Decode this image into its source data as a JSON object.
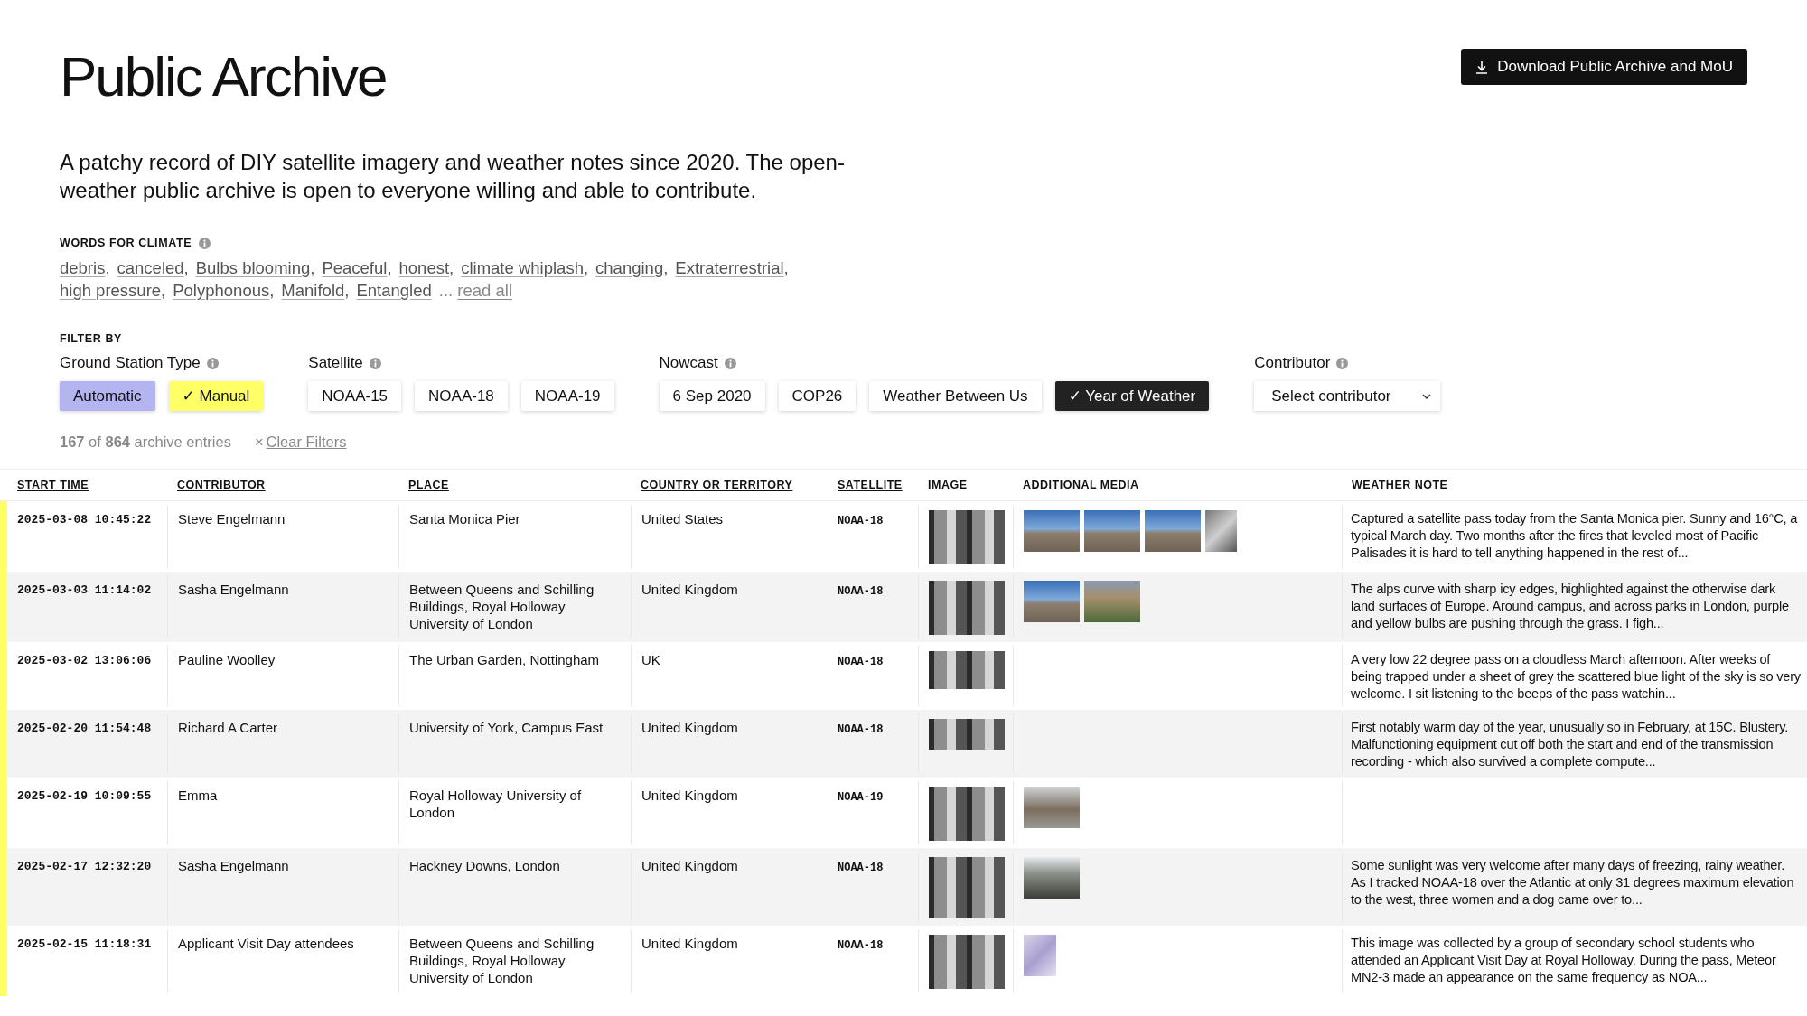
{
  "header": {
    "title": "Public Archive",
    "download_button": "Download Public Archive and MoU",
    "description": "A patchy record of DIY satellite imagery and weather notes since 2020. The open-weather public archive is open to everyone willing and able to contribute."
  },
  "words_for_climate": {
    "label": "WORDS FOR CLIMATE",
    "words": [
      {
        "text": "debris",
        "after": ","
      },
      {
        "text": "canceled",
        "after": ","
      },
      {
        "text": "Bulbs blooming",
        "after": ","
      },
      {
        "text": "Peaceful",
        "after": ","
      },
      {
        "text": "honest",
        "after": ","
      },
      {
        "text": "climate whiplash",
        "after": ","
      },
      {
        "text": "changing",
        "after": ","
      },
      {
        "text": "Extraterrestrial",
        "after": ","
      },
      {
        "text": "high pressure",
        "after": ","
      },
      {
        "text": "Polyphonous",
        "after": ","
      },
      {
        "text": "Manifold",
        "after": ","
      },
      {
        "text": "Entangled"
      }
    ],
    "ellipsis": "...",
    "read_all": "read all"
  },
  "filter": {
    "label": "FILTER BY",
    "groups": [
      {
        "label": "Ground Station Type",
        "options": [
          {
            "label": "Automatic",
            "selected": false,
            "color": "#b3b4f0"
          },
          {
            "label": "Manual",
            "selected": true,
            "color": "#ffff66"
          }
        ]
      },
      {
        "label": "Satellite",
        "options": [
          {
            "label": "NOAA-15",
            "selected": false
          },
          {
            "label": "NOAA-18",
            "selected": false
          },
          {
            "label": "NOAA-19",
            "selected": false
          }
        ]
      },
      {
        "label": "Nowcast",
        "options": [
          {
            "label": "6 Sep 2020",
            "selected": false
          },
          {
            "label": "COP26",
            "selected": false
          },
          {
            "label": "Weather Between Us",
            "selected": false
          },
          {
            "label": "Year of Weather",
            "selected": true
          }
        ]
      }
    ],
    "contributor": {
      "label": "Contributor",
      "placeholder": "Select contributor"
    },
    "check_mark": "✓",
    "count": "**167** of **864** archive entries",
    "clear_icon": "×",
    "clear": "Clear Filters"
  },
  "table": {
    "columns": [
      "START TIME",
      "CONTRIBUTOR",
      "PLACE",
      "COUNTRY OR TERRITORY",
      "SATELLITE",
      "IMAGE",
      "ADDITIONAL MEDIA",
      "WEATHER NOTE"
    ],
    "rows": [
      {
        "start_time": "2025-03-08 10:45:22",
        "contributor": "Steve Engelmann",
        "place": "Santa Monica Pier",
        "country": "United States",
        "satellite": "NOAA-18",
        "image": {
          "kind": "tall"
        },
        "media": [
          {
            "kind": "sky"
          },
          {
            "kind": "sky"
          },
          {
            "kind": "sky"
          },
          {
            "kind": "narrow"
          }
        ],
        "note": "Captured a satellite pass today from the Santa Monica pier. Sunny and 16°C, a typical March day. Two months after the fires that leveled most of Pacific Palisades it is hard to tell anything happened in the rest of..."
      },
      {
        "start_time": "2025-03-03 11:14:02",
        "contributor": "Sasha Engelmann",
        "place": "Between Queens and Schilling Buildings, Royal Holloway University of London",
        "country": "United Kingdom",
        "satellite": "NOAA-18",
        "image": {
          "kind": "tall"
        },
        "media": [
          {
            "kind": "sky"
          },
          {
            "kind": "grass"
          }
        ],
        "note": "The alps curve with sharp icy edges, highlighted against the otherwise dark land surfaces of Europe. Around campus, and across parks in London, purple and yellow bulbs are pushing through the grass. I figh..."
      },
      {
        "start_time": "2025-03-02 13:06:06",
        "contributor": "Pauline Woolley",
        "place": "The Urban Garden, Nottingham",
        "country": "UK",
        "satellite": "NOAA-18",
        "image": {
          "kind": "wide"
        },
        "note": "A very low 22 degree pass on a cloudless March afternoon. After weeks of being trapped under a sheet of grey the scattered blue light of the sky is so very welcome. I sit listening to the beeps of the pass watchin..."
      },
      {
        "start_time": "2025-02-20 11:54:48",
        "contributor": "Richard A Carter",
        "place": "University of York, Campus East",
        "country": "United Kingdom",
        "satellite": "NOAA-18",
        "image": {
          "kind": "short"
        },
        "note": "First notably warm day of the year, unusually so in February, at 15C. Blustery. Malfunctioning equipment cut off both the start and end of the transmission recording - which also survived a complete compute..."
      },
      {
        "start_time": "2025-02-19 10:09:55",
        "contributor": "Emma",
        "place": "Royal Holloway University of London",
        "country": "United Kingdom",
        "satellite": "NOAA-19",
        "image": {
          "kind": "tall"
        },
        "media": [
          {
            "kind": "grey"
          }
        ]
      },
      {
        "start_time": "2025-02-17 12:32:20",
        "contributor": "Sasha Engelmann",
        "place": "Hackney Downs, London",
        "country": "United Kingdom",
        "satellite": "NOAA-18",
        "image": {
          "kind": "taller"
        },
        "media": [
          {
            "kind": "dark"
          }
        ],
        "note": "Some sunlight was very welcome after many days of freezing, rainy weather. As I tracked NOAA-18 over the Atlantic at only 31 degrees maximum elevation to the west, three women and a dog came over to..."
      },
      {
        "start_time": "2025-02-15 11:18:31",
        "contributor": "Applicant Visit Day attendees",
        "place": "Between Queens and Schilling Buildings, Royal Holloway University of London",
        "country": "United Kingdom",
        "satellite": "NOAA-18",
        "image": {
          "kind": "tall"
        },
        "media": [
          {
            "kind": "narrow-light"
          }
        ],
        "note": "This image was collected by a group of secondary school students who attended an Applicant Visit Day at Royal Holloway. During the pass, Meteor MN2-3 made an appearance on the same frequency as NOA..."
      }
    ]
  }
}
